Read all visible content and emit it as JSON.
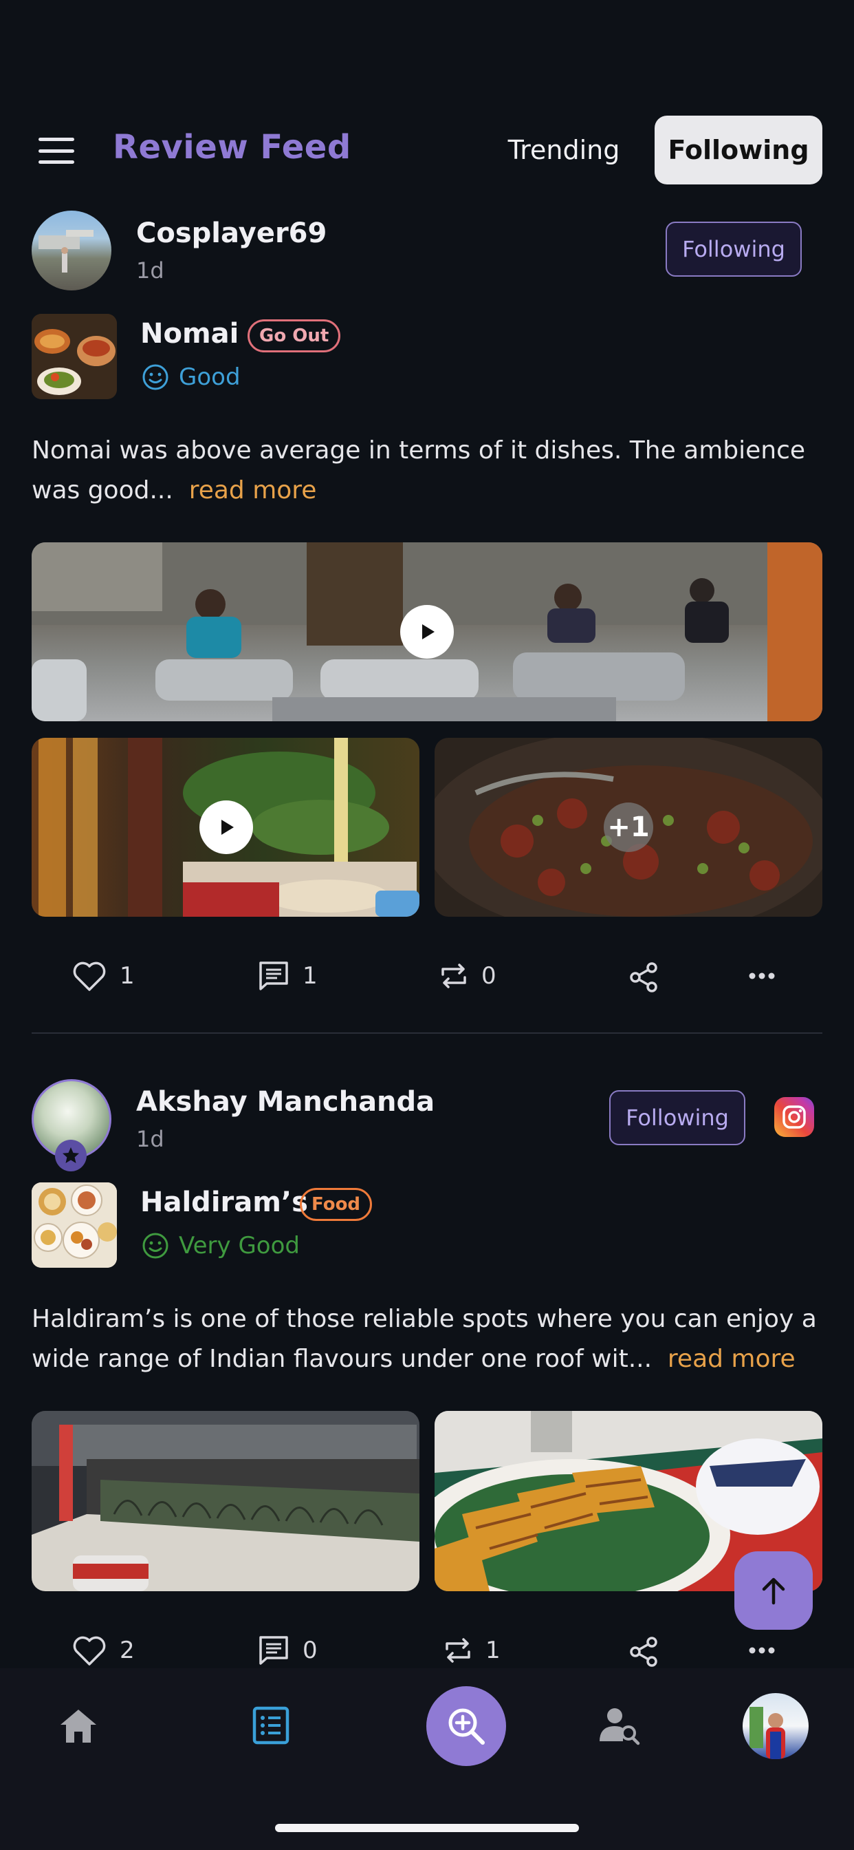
{
  "header": {
    "title": "Review Feed",
    "tabs": [
      {
        "label": "Trending",
        "active": false
      },
      {
        "label": "Following",
        "active": true
      }
    ]
  },
  "posts": [
    {
      "user": "Cosplayer69",
      "time": "1d",
      "follow_label": "Following",
      "place": "Nomai",
      "tag": "Go Out",
      "tag_color": "#e0707a",
      "rating": "Good",
      "rating_color": "#3ea0d8",
      "text": "Nomai was above average in terms of it dishes. The ambience was good...",
      "read_more": "read more",
      "extra_media": "+1",
      "likes": "1",
      "comments": "1",
      "reposts": "0"
    },
    {
      "user": "Akshay Manchanda",
      "time": "1d",
      "follow_label": "Following",
      "place": "Haldiram’s",
      "tag": "Food",
      "tag_color": "#ee7a3a",
      "rating": "Very Good",
      "rating_color": "#3f9a3f",
      "text": "Haldiram’s is one of those reliable spots where you can enjoy a wide range of Indian flavours under one roof wit...",
      "read_more": "read more",
      "likes": "2",
      "comments": "0",
      "reposts": "1"
    }
  ],
  "icons": {
    "menu": "hamburger-icon",
    "like": "heart-icon",
    "comment": "comment-icon",
    "repost": "repost-icon",
    "share": "share-icon",
    "more": "more-icon",
    "instagram": "instagram-icon",
    "scroll_top": "arrow-up-icon"
  },
  "nav": [
    "home-icon",
    "list-icon",
    "search-zoom-icon",
    "user-search-icon",
    "profile-avatar"
  ],
  "colors": {
    "accent": "#8f7ad4",
    "background": "#0d1117",
    "read_more": "#e8a24a"
  }
}
